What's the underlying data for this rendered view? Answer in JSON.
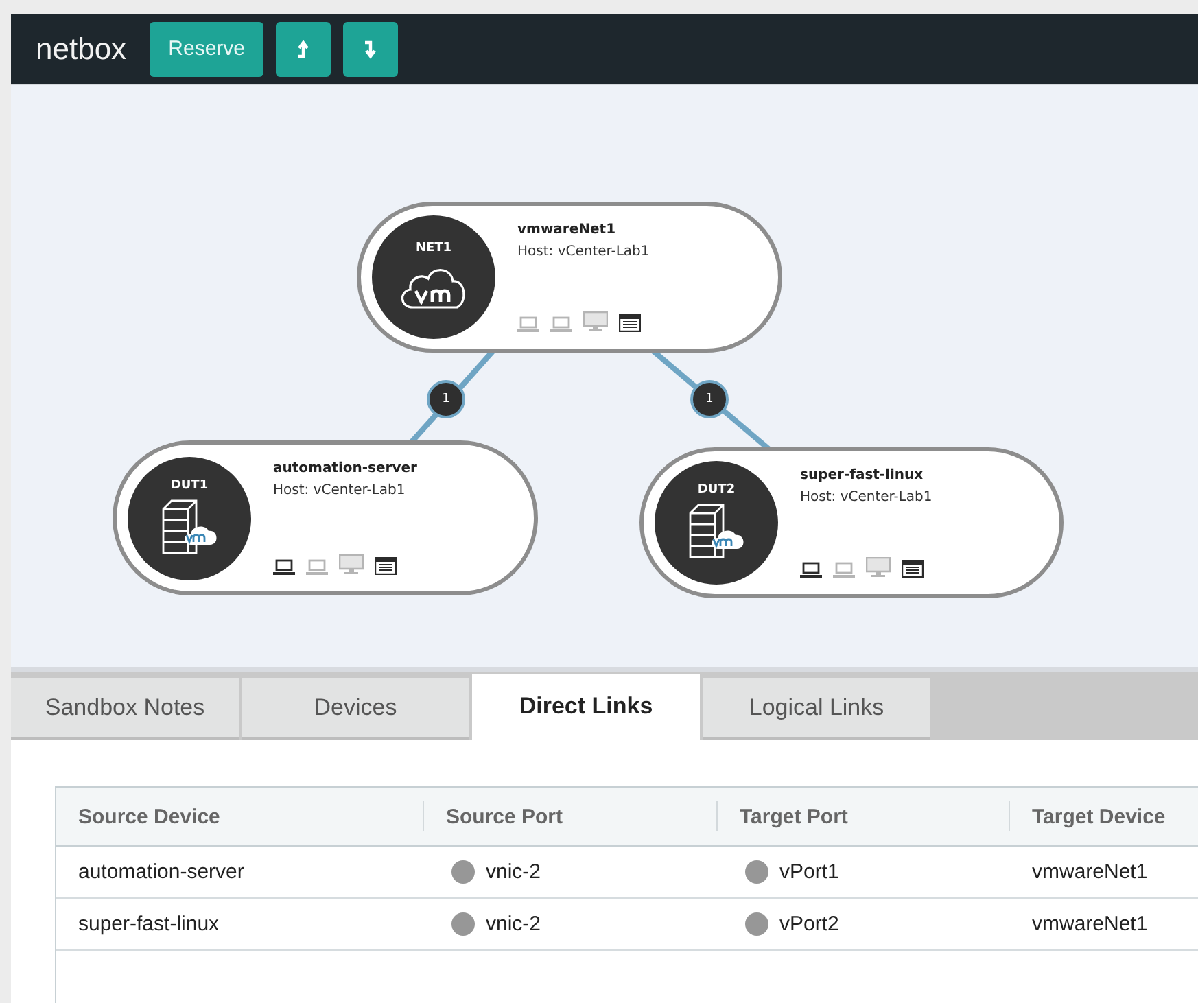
{
  "header": {
    "brand": "netbox",
    "buttons": [
      {
        "kind": "text",
        "label": "Reserve"
      },
      {
        "kind": "upload"
      },
      {
        "kind": "download"
      }
    ]
  },
  "diagram": {
    "nodes": [
      {
        "badge": "NET1",
        "kind": "network",
        "name": "vmwareNet1",
        "host": "Host: vCenter-Lab1",
        "interfaces": [
          {
            "kind": "laptop",
            "active": false
          },
          {
            "kind": "laptop",
            "active": false
          },
          {
            "kind": "monitor",
            "active": false
          },
          {
            "kind": "console",
            "active": true
          }
        ]
      },
      {
        "badge": "DUT1",
        "kind": "server",
        "name": "automation-server",
        "host": "Host: vCenter-Lab1",
        "interfaces": [
          {
            "kind": "laptop",
            "active": true
          },
          {
            "kind": "laptop",
            "active": false
          },
          {
            "kind": "monitor",
            "active": false
          },
          {
            "kind": "console",
            "active": true
          }
        ]
      },
      {
        "badge": "DUT2",
        "kind": "server",
        "name": "super-fast-linux",
        "host": "Host: vCenter-Lab1",
        "interfaces": [
          {
            "kind": "laptop",
            "active": true
          },
          {
            "kind": "laptop",
            "active": false
          },
          {
            "kind": "monitor",
            "active": false
          },
          {
            "kind": "console",
            "active": true
          }
        ]
      }
    ],
    "links": [
      {
        "count": "1"
      },
      {
        "count": "1"
      }
    ]
  },
  "tabs": [
    {
      "label": "Sandbox Notes",
      "selected": false
    },
    {
      "label": "Devices",
      "selected": false
    },
    {
      "label": "Direct Links",
      "selected": true
    },
    {
      "label": "Logical Links",
      "selected": false
    }
  ],
  "table": {
    "columns": [
      "Source Device",
      "Source Port",
      "Target Port",
      "Target Device"
    ],
    "rows": [
      [
        "automation-server",
        "vnic-2",
        "vPort1",
        "vmwareNet1"
      ],
      [
        "super-fast-linux",
        "vnic-2",
        "vPort2",
        "vmwareNet1"
      ]
    ]
  }
}
